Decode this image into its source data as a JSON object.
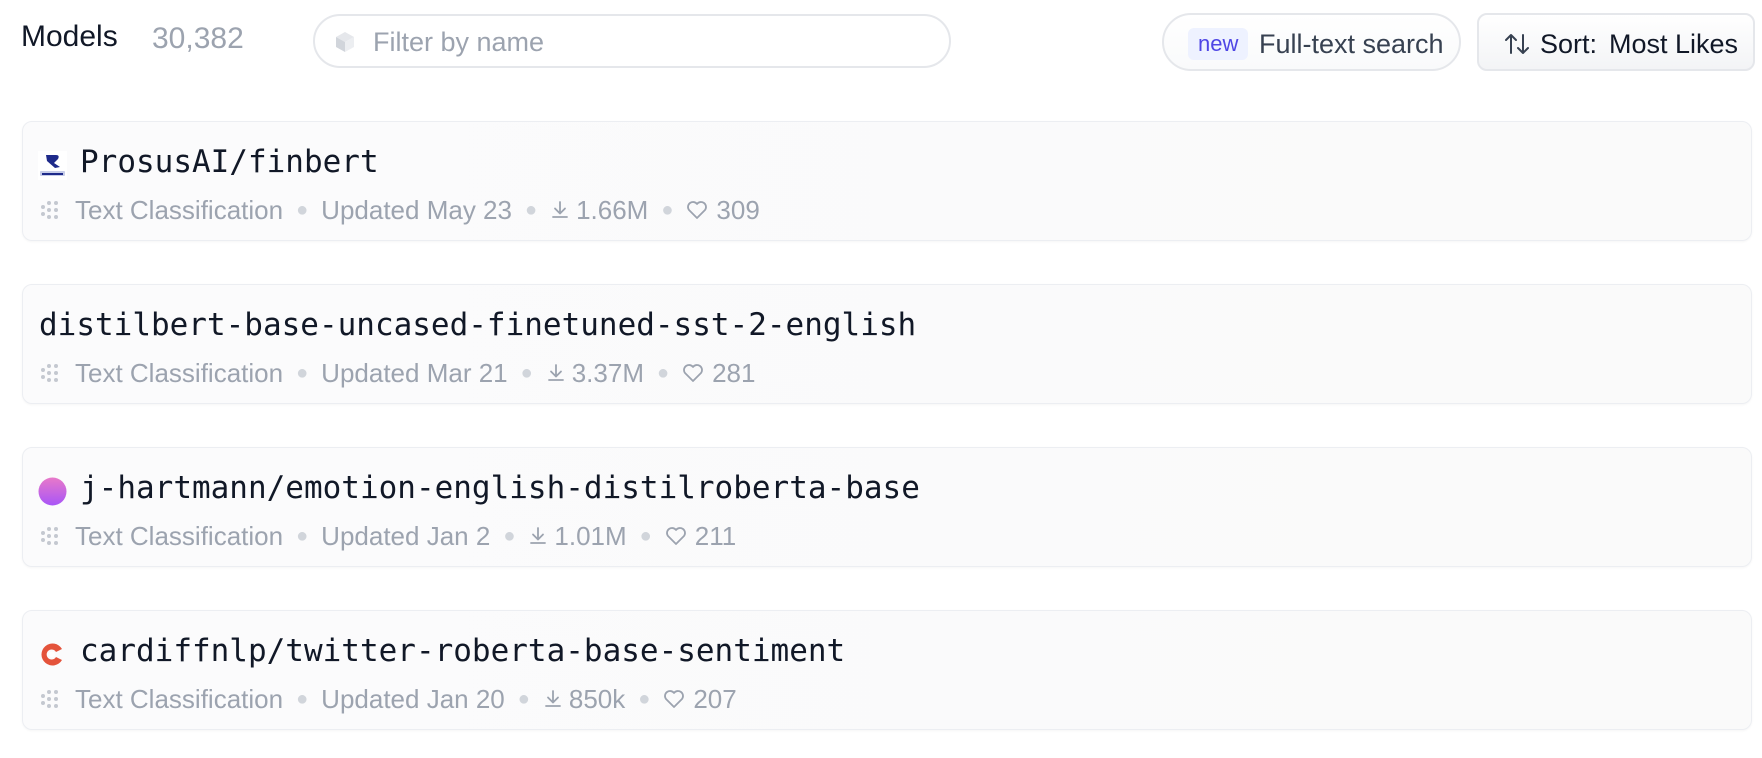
{
  "header": {
    "title": "Models",
    "count": "30,382",
    "search": {
      "placeholder": "Filter by name",
      "value": ""
    },
    "fulltext": {
      "badge": "new",
      "label": "Full-text search"
    },
    "sort": {
      "prefix": "Sort:",
      "value": "Most Likes"
    }
  },
  "models": [
    {
      "name": "ProsusAI/finbert",
      "avatar": "prosus-logo",
      "task": "Text Classification",
      "updated": "Updated May 23",
      "downloads": "1.66M",
      "likes": "309"
    },
    {
      "name": "distilbert-base-uncased-finetuned-sst-2-english",
      "avatar": "",
      "task": "Text Classification",
      "updated": "Updated Mar 21",
      "downloads": "3.37M",
      "likes": "281"
    },
    {
      "name": "j-hartmann/emotion-english-distilroberta-base",
      "avatar": "gradient-circle",
      "task": "Text Classification",
      "updated": "Updated Jan 2",
      "downloads": "1.01M",
      "likes": "211"
    },
    {
      "name": "cardiffnlp/twitter-roberta-base-sentiment",
      "avatar": "cardiff-logo",
      "task": "Text Classification",
      "updated": "Updated Jan 20",
      "downloads": "850k",
      "likes": "207"
    }
  ],
  "icons": {
    "filter": "cube-icon",
    "sort": "sort-arrows-icon",
    "task": "text-classification-icon",
    "downloads": "download-icon",
    "likes": "heart-icon"
  },
  "colors": {
    "badge_text": "#4f46e5",
    "badge_bg": "#eef2ff",
    "muted": "#9ca3af",
    "prosus": "#1e2a8a",
    "cardiff": "#e4533b"
  }
}
